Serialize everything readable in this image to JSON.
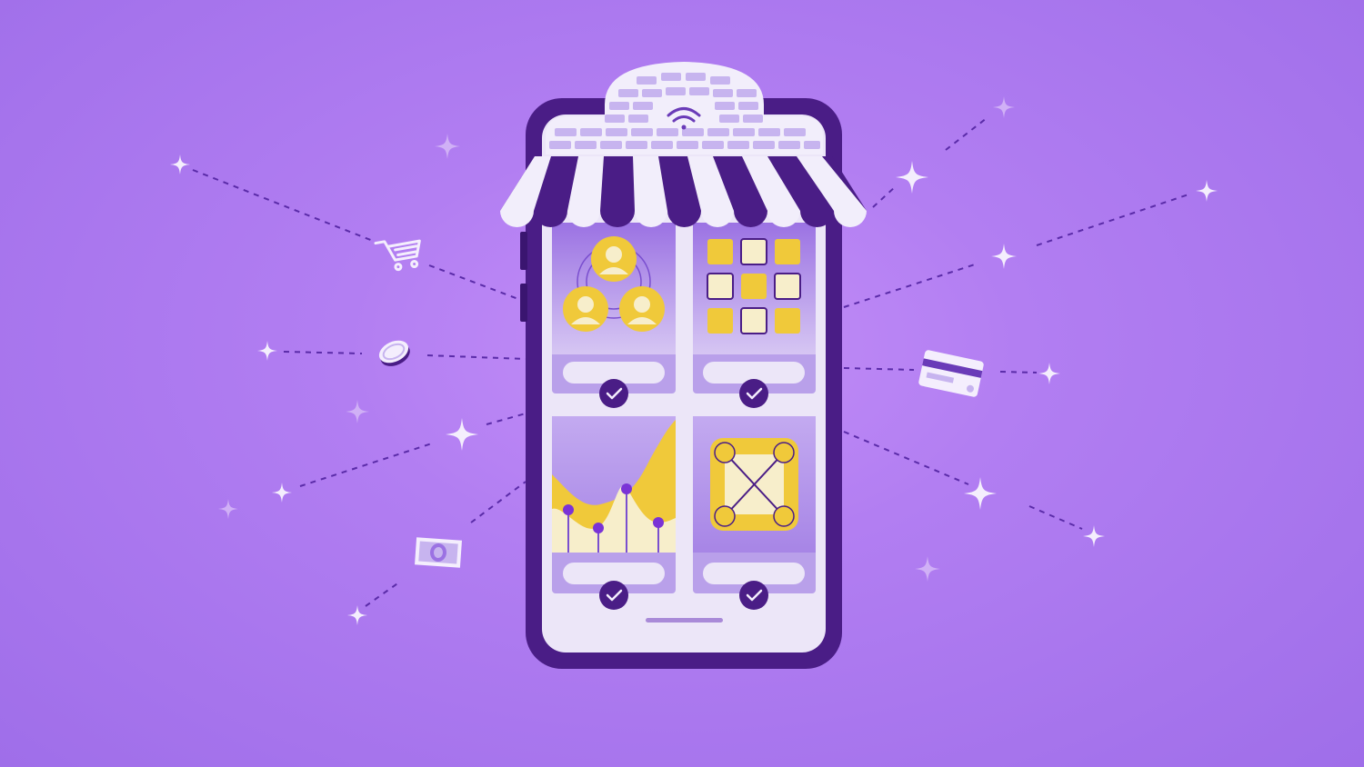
{
  "colors": {
    "background": "#b27ef2",
    "phone_frame": "#4a1d86",
    "screen": "#ece6f8",
    "card": "#b9a0ea",
    "accent_yellow": "#f0c93a",
    "awning_purple": "#4a1d86",
    "awning_white": "#f2eefb"
  },
  "icons": {
    "wifi": "wifi-icon",
    "cart": "shopping-cart-icon",
    "coin": "coin-icon",
    "bill": "banknote-icon",
    "card": "credit-card-icon",
    "check": "checkmark-icon",
    "sparkle": "sparkle-icon"
  },
  "tiles": [
    {
      "name": "people-network-tile",
      "checked": true
    },
    {
      "name": "app-grid-tile",
      "checked": true
    },
    {
      "name": "analytics-chart-tile",
      "checked": true
    },
    {
      "name": "connection-flow-tile",
      "checked": true
    }
  ]
}
